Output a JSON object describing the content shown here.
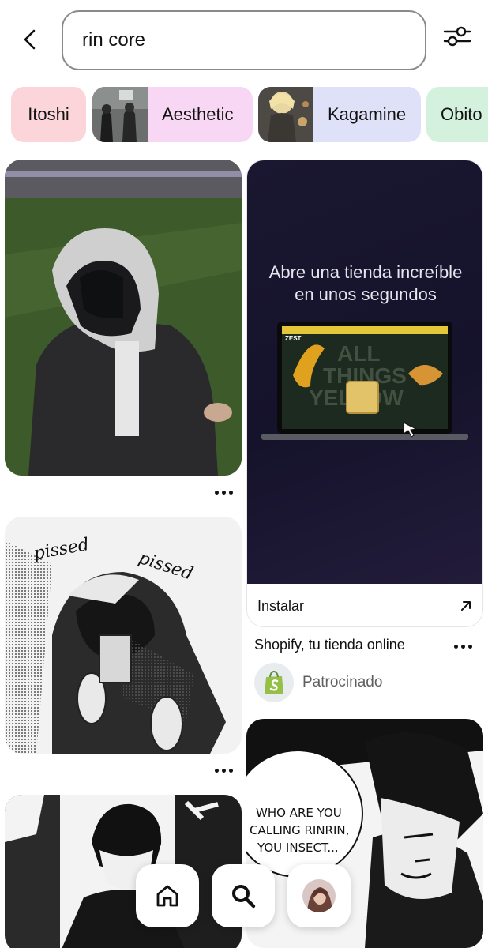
{
  "search": {
    "query": "rin core"
  },
  "chips": [
    {
      "label": "Itoshi"
    },
    {
      "label": "Aesthetic"
    },
    {
      "label": "Kagamine"
    },
    {
      "label": "Obito"
    }
  ],
  "ad": {
    "headline_line1": "Abre una tienda increíble",
    "headline_line2": "en unos segundos",
    "mock_brand": "ZEST",
    "mock_bg_line1": "ALL",
    "mock_bg_line2": "THINGS",
    "mock_bg_line3": "YELLOW",
    "cta": "Instalar",
    "title": "Shopify, tu tienda online",
    "sponsor_label": "Patrocinado"
  },
  "pins": {
    "manga1_text1": "pissed",
    "manga1_text2": "pissed",
    "manga3_bubble_line1": "WHO ARE YOU",
    "manga3_bubble_line2": "CALLING RINRIN,",
    "manga3_bubble_line3": "YOU INSECT..."
  },
  "colors": {
    "chip_itoshi": "#fbd5d9",
    "chip_aesthetic": "#f7d7f3",
    "chip_kagamine": "#dfe1f9",
    "chip_obito": "#d4f1de",
    "shopify_green": "#95bf47"
  },
  "icons": {
    "back": "chevron-left-icon",
    "filter": "sliders-icon",
    "more": "ellipsis-icon",
    "external": "arrow-up-right-icon",
    "home": "home-icon",
    "search": "search-icon"
  }
}
